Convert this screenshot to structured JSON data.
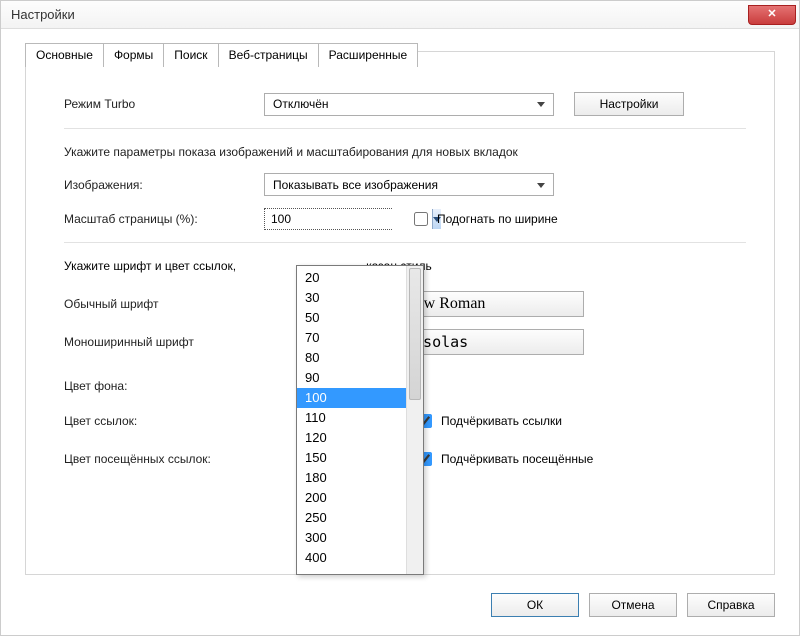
{
  "window": {
    "title": "Настройки"
  },
  "tabs": {
    "items": [
      {
        "label": "Основные"
      },
      {
        "label": "Формы"
      },
      {
        "label": "Поиск"
      },
      {
        "label": "Веб-страницы"
      },
      {
        "label": "Расширенные"
      }
    ],
    "active": 3
  },
  "turbo": {
    "label": "Режим Turbo",
    "value": "Отключён",
    "settings_btn": "Настройки"
  },
  "images_section": {
    "note": "Укажите параметры показа изображений и масштабирования для новых вкладок",
    "images_label": "Изображения:",
    "images_value": "Показывать все изображения",
    "zoom_label": "Масштаб страницы (%):",
    "zoom_value": "100",
    "fit_width_label": "Подогнать по ширине",
    "fit_width_checked": false,
    "zoom_options": [
      "20",
      "30",
      "50",
      "70",
      "80",
      "90",
      "100",
      "110",
      "120",
      "150",
      "180",
      "200",
      "250",
      "300",
      "400"
    ],
    "zoom_selected": "100"
  },
  "fonts_section": {
    "note_partial": "Укажите шрифт и цвет ссылок,",
    "note_tail": "казан стиль",
    "normal_font_label": "Обычный шрифт",
    "normal_font_btn_visible": "New Roman",
    "mono_font_label": "Моноширинный шрифт",
    "mono_font_btn_visible": "onsolas"
  },
  "colors_section": {
    "bg_label": "Цвет фона:",
    "links_label": "Цвет ссылок:",
    "visited_label": "Цвет посещённых ссылок:",
    "underline_links": {
      "label": "Подчёркивать ссылки",
      "checked": true
    },
    "underline_visited": {
      "label": "Подчёркивать посещённые",
      "checked": true
    }
  },
  "buttons": {
    "ok": "ОК",
    "cancel": "Отмена",
    "help": "Справка"
  }
}
